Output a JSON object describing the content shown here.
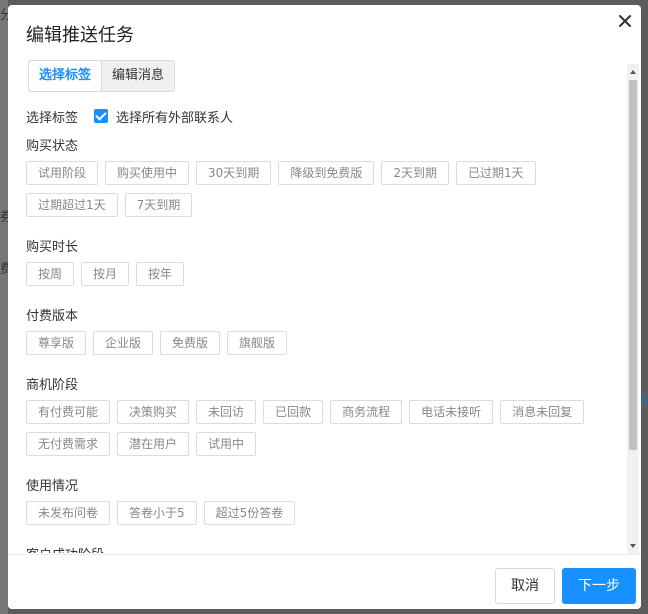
{
  "dialog": {
    "title": "编辑推送任务",
    "tabs": [
      {
        "label": "选择标签",
        "active": true
      },
      {
        "label": "编辑消息",
        "active": false
      }
    ],
    "select_all": {
      "field_label": "选择标签",
      "checkbox_label": "选择所有外部联系人",
      "checked": true
    },
    "groups": [
      {
        "title": "购买状态",
        "tags": [
          "试用阶段",
          "购买使用中",
          "30天到期",
          "降级到免费版",
          "2天到期",
          "已过期1天",
          "过期超过1天",
          "7天到期"
        ]
      },
      {
        "title": "购买时长",
        "tags": [
          "按周",
          "按月",
          "按年"
        ]
      },
      {
        "title": "付费版本",
        "tags": [
          "尊享版",
          "企业版",
          "免费版",
          "旗舰版"
        ]
      },
      {
        "title": "商机阶段",
        "tags": [
          "有付费可能",
          "决策购买",
          "未回访",
          "已回款",
          "商务流程",
          "电话未接听",
          "消息未回复",
          "无付费需求",
          "潜在用户",
          "试用中"
        ]
      },
      {
        "title": "使用情况",
        "tags": [
          "未发布问卷",
          "答卷小于5",
          "超过5份答卷"
        ]
      },
      {
        "title": "客户成功阶段",
        "tags": []
      }
    ],
    "footer": {
      "cancel_label": "取消",
      "next_label": "下一步"
    },
    "colors": {
      "accent": "#1890ff"
    }
  }
}
